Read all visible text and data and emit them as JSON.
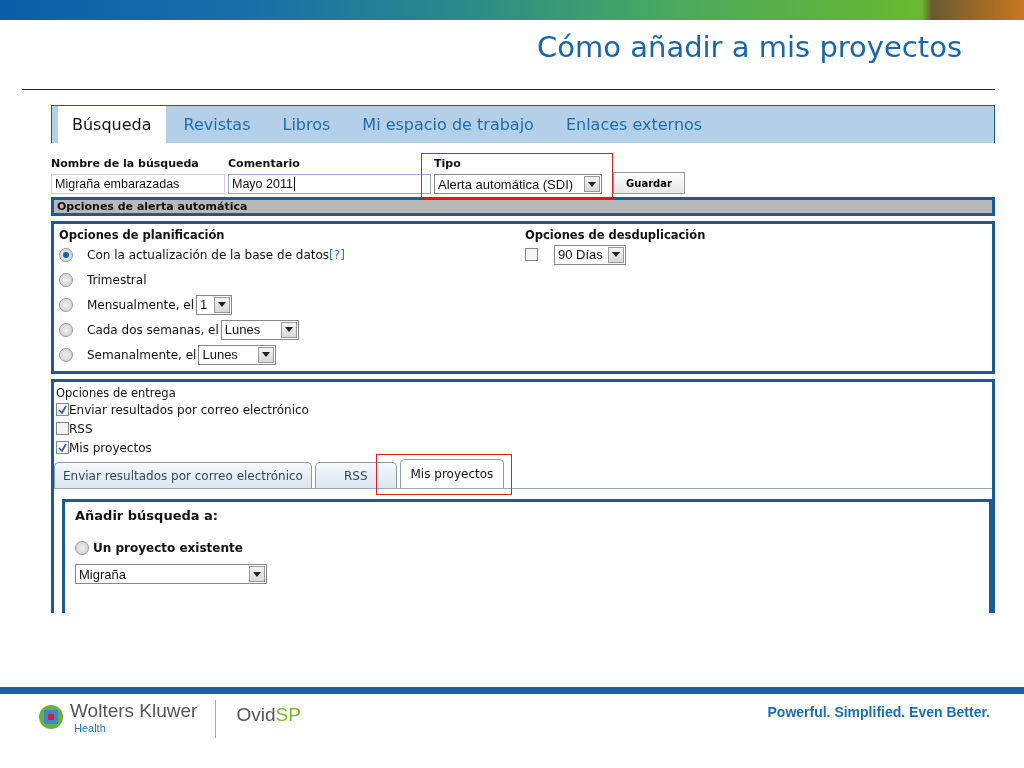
{
  "slide_title": "Cómo añadir a mis proyectos",
  "nav_tabs": [
    {
      "label": "Búsqueda",
      "selected": true
    },
    {
      "label": "Revistas",
      "selected": false
    },
    {
      "label": "Libros",
      "selected": false
    },
    {
      "label": "Mi espacio de trabajo",
      "selected": false
    },
    {
      "label": "Enlaces externos",
      "selected": false
    }
  ],
  "search_form": {
    "name_label": "Nombre de la búsqueda",
    "name_value": "Migraña embarazadas",
    "comment_label": "Comentario",
    "comment_value": "Mayo 2011",
    "type_label": "Tipo",
    "type_value": "Alerta automática (SDI)",
    "type_highlighted": true,
    "save_button": "Guardar"
  },
  "alert_header": "Opciones de alerta automática",
  "planning": {
    "title": "Opciones de planificación",
    "options": [
      {
        "label": "Con la actualización de la base de datos",
        "help": "[?]",
        "selected": true
      },
      {
        "label": "Trimestral",
        "selected": false
      },
      {
        "label": "Mensualmente, el",
        "select": "1",
        "selected": false
      },
      {
        "label": "Cada dos semanas, el",
        "select": "Lunes",
        "selected": false
      },
      {
        "label": "Semanalmente, el",
        "select": "Lunes",
        "selected": false
      }
    ]
  },
  "dedup": {
    "title": "Opciones de desduplicación",
    "checked": false,
    "select": "90 Días"
  },
  "delivery": {
    "title": "Opciones de entrega",
    "checkboxes": [
      {
        "label": "Enviar resultados por correo electrónico",
        "checked": true
      },
      {
        "label": "RSS",
        "checked": false
      },
      {
        "label": "Mis proyectos",
        "checked": true
      }
    ],
    "tabs": [
      {
        "label": "Enviar resultados por correo electrónico",
        "selected": false,
        "highlighted": false
      },
      {
        "label": "RSS",
        "selected": false,
        "highlighted": false
      },
      {
        "label": "Mis proyectos",
        "selected": true,
        "highlighted": true
      }
    ],
    "panel": {
      "title": "Añadir búsqueda a:",
      "radio": {
        "label": "Un proyecto existente",
        "selected": false
      },
      "select": "Migraña"
    }
  },
  "footer": {
    "brand": "Wolters Kluwer",
    "division": "Health",
    "product": "Ovid",
    "product_suffix": "SP",
    "tagline": "Powerful. Simplified. Even Better."
  }
}
